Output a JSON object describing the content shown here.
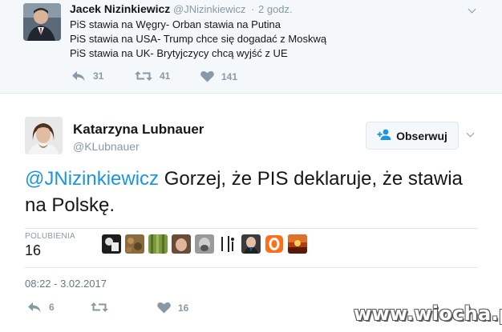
{
  "parent_tweet": {
    "author_name": "Jacek Nizinkiewicz",
    "author_handle": "@JNizinkiewicz",
    "separator": "·",
    "time": "2 godz.",
    "lines": [
      "PiS stawia na Węgry- Orban stawia na Putina",
      "PiS stawia na USA- Trump chce się dogadać z Moskwą",
      "PiS stawia na UK- Brytyjczycy chcą wyjść z UE"
    ],
    "actions": {
      "reply_count": "31",
      "retweet_count": "41",
      "like_count": "141"
    },
    "icons": [
      "reply-icon",
      "retweet-icon",
      "heart-icon",
      "chevron-down-icon"
    ]
  },
  "main_tweet": {
    "author_name": "Katarzyna Lubnauer",
    "author_handle": "@KLubnauer",
    "follow_label": "Obserwuj",
    "text_mention": "@JNizinkiewicz",
    "text_body": " Gorzej, że PIS deklaruje, że stawia na Polskę.",
    "likes_label": "POLUBIENIA",
    "likes_count": "16",
    "liker_avatar_count": 9,
    "timestamp": "08:22 - 3.02.2017",
    "actions": {
      "reply_count": "6",
      "retweet_count": "",
      "like_count": "16"
    }
  },
  "watermark": "www.wiocha.pl",
  "colors": {
    "link": "#1b95e0",
    "muted": "#8899a6",
    "text": "#14171a",
    "parent_background": "#f5f8fa",
    "border": "#e1e8ed"
  }
}
